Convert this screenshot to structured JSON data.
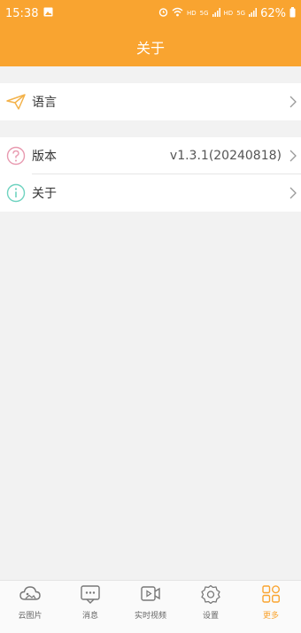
{
  "statusbar": {
    "time": "15:38",
    "net1": "HD",
    "net2": "HD",
    "sig1": "5G",
    "sig2": "5G",
    "battery": "62%"
  },
  "header": {
    "title": "关于"
  },
  "group1": {
    "language": {
      "label": "语言",
      "icon": "paper-plane-icon"
    }
  },
  "group2": {
    "version": {
      "label": "版本",
      "value": "v1.3.1(20240818)",
      "icon": "question-circle-icon"
    },
    "about": {
      "label": "关于",
      "icon": "info-circle-icon"
    }
  },
  "tabbar": {
    "items": [
      {
        "label": "云图片",
        "icon": "cloud-image-icon"
      },
      {
        "label": "消息",
        "icon": "message-icon"
      },
      {
        "label": "实时视频",
        "icon": "video-icon"
      },
      {
        "label": "设置",
        "icon": "gear-icon"
      },
      {
        "label": "更多",
        "icon": "grid-more-icon"
      }
    ],
    "active_index": 4
  },
  "colors": {
    "accent": "#f9a430",
    "background": "#f2f2f2"
  }
}
